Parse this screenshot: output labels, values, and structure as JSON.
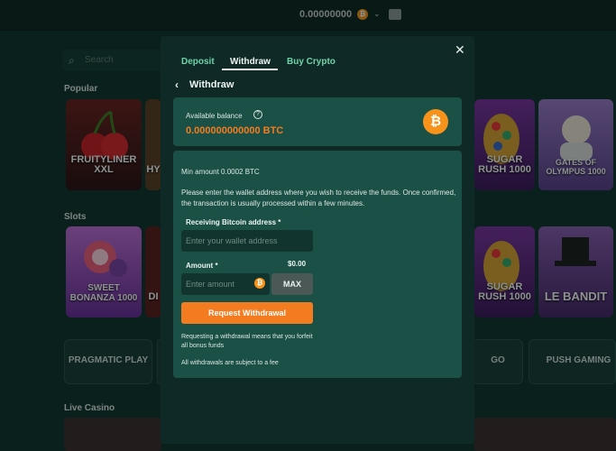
{
  "topbar": {
    "balance": "0.00000000",
    "currency_icon": "bitcoin-icon",
    "wallet_icon": "wallet-icon"
  },
  "background": {
    "search_placeholder": "Search",
    "sections": [
      "Popular",
      "Slots",
      "Live Casino"
    ],
    "popular_games": [
      "FRUITYLINER XXL",
      "HY",
      "SUGAR RUSH 1000",
      "GATES OF OLYMPUS 1000"
    ],
    "slot_games": [
      "SWEET BONANZA 1000",
      "DI",
      "SUGAR RUSH 1000",
      "LE BANDIT"
    ],
    "providers": [
      "PRAGMATIC PLAY",
      "GO",
      "PUSH GAMING"
    ]
  },
  "modal": {
    "tabs": [
      {
        "label": "Deposit",
        "active": false
      },
      {
        "label": "Withdraw",
        "active": true
      },
      {
        "label": "Buy Crypto",
        "active": false
      }
    ],
    "close_icon": "close-icon",
    "back_icon": "chevron-left-icon",
    "title": "Withdraw",
    "balance_card": {
      "label": "Available balance",
      "help_icon": "help-icon",
      "value": "0.000000000000 BTC"
    },
    "form": {
      "min_amount": "Min amount 0.0002 BTC",
      "info": "Please enter the wallet address where you wish to receive the funds. Once confirmed, the transaction is usually processed within a few minutes.",
      "address_label": "Receiving Bitcoin address *",
      "address_placeholder": "Enter your wallet address",
      "amount_label": "Amount *",
      "amount_usd": "$0.00",
      "amount_placeholder": "Enter amount",
      "max_label": "MAX",
      "submit_label": "Request Withdrawal",
      "note_bonus": "Requesting a withdrawal means that you forfeit all bonus funds",
      "note_fee": "All withdrawals are subject to a fee"
    }
  },
  "colors": {
    "accent_orange": "#f47c20",
    "tab_green": "#6fd3a8",
    "card_bg": "#1b5046",
    "modal_bg": "#0f2a26"
  }
}
